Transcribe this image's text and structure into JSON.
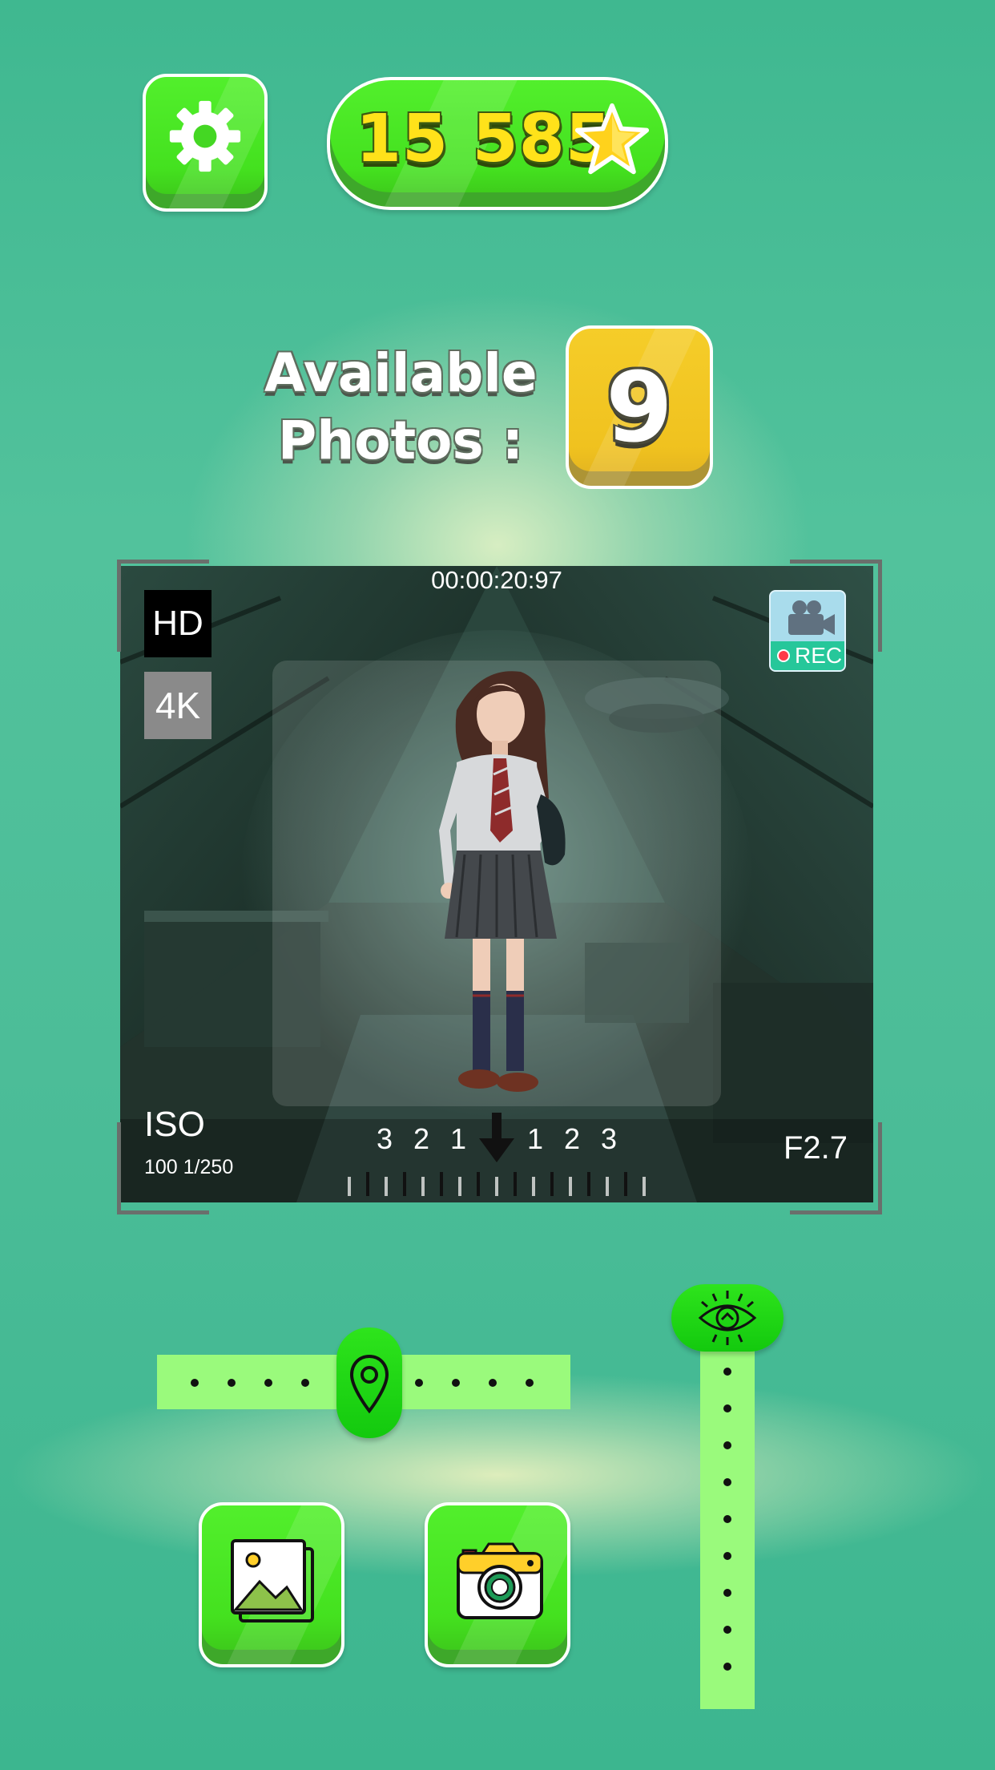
{
  "top_bar": {
    "settings_icon": "gear-icon",
    "score_value": "15 585",
    "score_icon": "star-icon"
  },
  "photos": {
    "label_line1": "Available",
    "label_line2": "Photos :",
    "count": "9"
  },
  "viewfinder": {
    "timer": "00:00:20:97",
    "quality_hd": "HD",
    "quality_4k": "4K",
    "rec_label": "REC",
    "rec_icon": "video-camera-icon",
    "iso_label": "ISO",
    "iso_values": "100 1/250",
    "aperture": "F2.7",
    "exposure_scale": [
      "3",
      "2",
      "1",
      "1",
      "2",
      "3"
    ],
    "exposure_pointer_icon": "arrow-down-icon"
  },
  "controls": {
    "horizontal_slider_icon": "location-pin-icon",
    "vertical_slider_icon": "eye-icon",
    "gallery_icon": "gallery-icon",
    "camera_icon": "camera-icon"
  },
  "colors": {
    "button_green": "#44e11f",
    "slider_track": "#9afa7c",
    "count_yellow": "#f0c21f",
    "score_yellow": "#ffe21a"
  }
}
